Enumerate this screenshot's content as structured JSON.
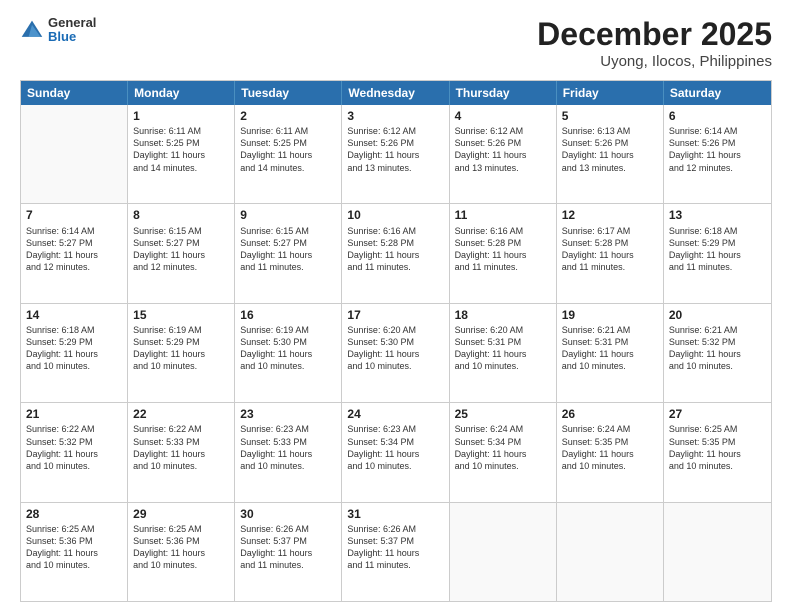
{
  "header": {
    "logo": {
      "general": "General",
      "blue": "Blue"
    },
    "title": "December 2025",
    "subtitle": "Uyong, Ilocos, Philippines"
  },
  "weekdays": [
    "Sunday",
    "Monday",
    "Tuesday",
    "Wednesday",
    "Thursday",
    "Friday",
    "Saturday"
  ],
  "rows": [
    [
      {
        "day": "",
        "info": ""
      },
      {
        "day": "1",
        "info": "Sunrise: 6:11 AM\nSunset: 5:25 PM\nDaylight: 11 hours\nand 14 minutes."
      },
      {
        "day": "2",
        "info": "Sunrise: 6:11 AM\nSunset: 5:25 PM\nDaylight: 11 hours\nand 14 minutes."
      },
      {
        "day": "3",
        "info": "Sunrise: 6:12 AM\nSunset: 5:26 PM\nDaylight: 11 hours\nand 13 minutes."
      },
      {
        "day": "4",
        "info": "Sunrise: 6:12 AM\nSunset: 5:26 PM\nDaylight: 11 hours\nand 13 minutes."
      },
      {
        "day": "5",
        "info": "Sunrise: 6:13 AM\nSunset: 5:26 PM\nDaylight: 11 hours\nand 13 minutes."
      },
      {
        "day": "6",
        "info": "Sunrise: 6:14 AM\nSunset: 5:26 PM\nDaylight: 11 hours\nand 12 minutes."
      }
    ],
    [
      {
        "day": "7",
        "info": "Sunrise: 6:14 AM\nSunset: 5:27 PM\nDaylight: 11 hours\nand 12 minutes."
      },
      {
        "day": "8",
        "info": "Sunrise: 6:15 AM\nSunset: 5:27 PM\nDaylight: 11 hours\nand 12 minutes."
      },
      {
        "day": "9",
        "info": "Sunrise: 6:15 AM\nSunset: 5:27 PM\nDaylight: 11 hours\nand 11 minutes."
      },
      {
        "day": "10",
        "info": "Sunrise: 6:16 AM\nSunset: 5:28 PM\nDaylight: 11 hours\nand 11 minutes."
      },
      {
        "day": "11",
        "info": "Sunrise: 6:16 AM\nSunset: 5:28 PM\nDaylight: 11 hours\nand 11 minutes."
      },
      {
        "day": "12",
        "info": "Sunrise: 6:17 AM\nSunset: 5:28 PM\nDaylight: 11 hours\nand 11 minutes."
      },
      {
        "day": "13",
        "info": "Sunrise: 6:18 AM\nSunset: 5:29 PM\nDaylight: 11 hours\nand 11 minutes."
      }
    ],
    [
      {
        "day": "14",
        "info": "Sunrise: 6:18 AM\nSunset: 5:29 PM\nDaylight: 11 hours\nand 10 minutes."
      },
      {
        "day": "15",
        "info": "Sunrise: 6:19 AM\nSunset: 5:29 PM\nDaylight: 11 hours\nand 10 minutes."
      },
      {
        "day": "16",
        "info": "Sunrise: 6:19 AM\nSunset: 5:30 PM\nDaylight: 11 hours\nand 10 minutes."
      },
      {
        "day": "17",
        "info": "Sunrise: 6:20 AM\nSunset: 5:30 PM\nDaylight: 11 hours\nand 10 minutes."
      },
      {
        "day": "18",
        "info": "Sunrise: 6:20 AM\nSunset: 5:31 PM\nDaylight: 11 hours\nand 10 minutes."
      },
      {
        "day": "19",
        "info": "Sunrise: 6:21 AM\nSunset: 5:31 PM\nDaylight: 11 hours\nand 10 minutes."
      },
      {
        "day": "20",
        "info": "Sunrise: 6:21 AM\nSunset: 5:32 PM\nDaylight: 11 hours\nand 10 minutes."
      }
    ],
    [
      {
        "day": "21",
        "info": "Sunrise: 6:22 AM\nSunset: 5:32 PM\nDaylight: 11 hours\nand 10 minutes."
      },
      {
        "day": "22",
        "info": "Sunrise: 6:22 AM\nSunset: 5:33 PM\nDaylight: 11 hours\nand 10 minutes."
      },
      {
        "day": "23",
        "info": "Sunrise: 6:23 AM\nSunset: 5:33 PM\nDaylight: 11 hours\nand 10 minutes."
      },
      {
        "day": "24",
        "info": "Sunrise: 6:23 AM\nSunset: 5:34 PM\nDaylight: 11 hours\nand 10 minutes."
      },
      {
        "day": "25",
        "info": "Sunrise: 6:24 AM\nSunset: 5:34 PM\nDaylight: 11 hours\nand 10 minutes."
      },
      {
        "day": "26",
        "info": "Sunrise: 6:24 AM\nSunset: 5:35 PM\nDaylight: 11 hours\nand 10 minutes."
      },
      {
        "day": "27",
        "info": "Sunrise: 6:25 AM\nSunset: 5:35 PM\nDaylight: 11 hours\nand 10 minutes."
      }
    ],
    [
      {
        "day": "28",
        "info": "Sunrise: 6:25 AM\nSunset: 5:36 PM\nDaylight: 11 hours\nand 10 minutes."
      },
      {
        "day": "29",
        "info": "Sunrise: 6:25 AM\nSunset: 5:36 PM\nDaylight: 11 hours\nand 10 minutes."
      },
      {
        "day": "30",
        "info": "Sunrise: 6:26 AM\nSunset: 5:37 PM\nDaylight: 11 hours\nand 11 minutes."
      },
      {
        "day": "31",
        "info": "Sunrise: 6:26 AM\nSunset: 5:37 PM\nDaylight: 11 hours\nand 11 minutes."
      },
      {
        "day": "",
        "info": ""
      },
      {
        "day": "",
        "info": ""
      },
      {
        "day": "",
        "info": ""
      }
    ]
  ]
}
